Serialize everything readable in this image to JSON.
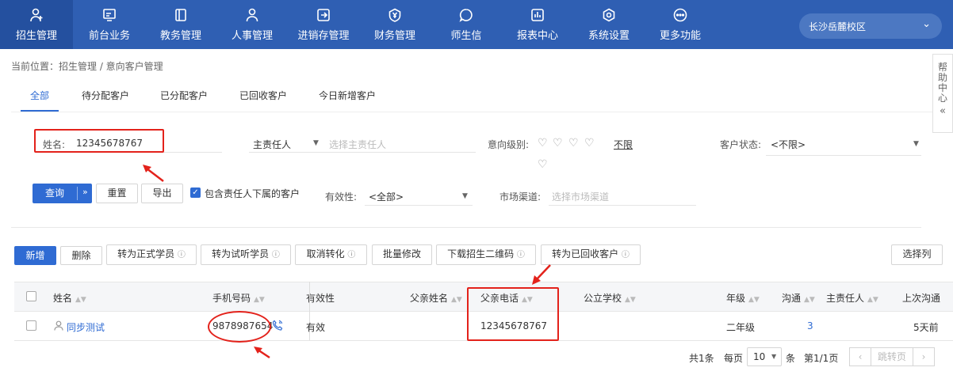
{
  "nav": {
    "items": [
      {
        "label": "招生管理",
        "icon": "user-add-icon",
        "active": true
      },
      {
        "label": "前台业务",
        "icon": "monitor-icon"
      },
      {
        "label": "教务管理",
        "icon": "book-icon"
      },
      {
        "label": "人事管理",
        "icon": "person-icon"
      },
      {
        "label": "进销存管理",
        "icon": "inventory-icon"
      },
      {
        "label": "财务管理",
        "icon": "yuan-shield-icon"
      },
      {
        "label": "师生信",
        "icon": "chat-icon"
      },
      {
        "label": "报表中心",
        "icon": "report-icon"
      },
      {
        "label": "系统设置",
        "icon": "settings-icon"
      },
      {
        "label": "更多功能",
        "icon": "more-icon"
      }
    ],
    "campus": "长沙岳麓校区"
  },
  "breadcrumb": "当前位置：招生管理 / 意向客户管理",
  "help": "帮助中心",
  "tabs": [
    "全部",
    "待分配客户",
    "已分配客户",
    "已回收客户",
    "今日新增客户"
  ],
  "filters": {
    "name_label": "姓名:",
    "name_value": "12345678767",
    "owner_label": "主责任人",
    "owner_placeholder": "选择主责任人",
    "level_label": "意向级别:",
    "level_unlimited": "不限",
    "status_label": "客户状态:",
    "status_value": "<不限>",
    "query": "查询",
    "reset": "重置",
    "export": "导出",
    "include_sub": "包含责任人下属的客户",
    "validity_label": "有效性:",
    "validity_value": "<全部>",
    "channel_label": "市场渠道:",
    "channel_placeholder": "选择市场渠道"
  },
  "actions": {
    "add": "新增",
    "delete": "删除",
    "to_formal": "转为正式学员",
    "to_trial": "转为试听学员",
    "cancel_convert": "取消转化",
    "batch_edit": "批量修改",
    "download_qr": "下载招生二维码",
    "to_recycled": "转为已回收客户",
    "select_columns": "选择列"
  },
  "table": {
    "headers": {
      "name": "姓名",
      "phone": "手机号码",
      "validity": "有效性",
      "father_name": "父亲姓名",
      "father_phone": "父亲电话",
      "school": "公立学校",
      "grade": "年级",
      "contact": "沟通",
      "owner": "主责任人",
      "last_contact": "上次沟通"
    },
    "rows": [
      {
        "name": "同步测试",
        "phone": "9878987654",
        "validity": "有效",
        "father_name": "",
        "father_phone": "12345678767",
        "school": "",
        "grade": "二年级",
        "contact": "3",
        "owner": "",
        "last_contact": "5天前"
      }
    ]
  },
  "pagination": {
    "total": "共1条",
    "per_page_label": "每页",
    "per_page": "10",
    "unit": "条",
    "page": "第1/1页",
    "jump": "跳转页"
  },
  "colors": {
    "nav_bg": "#2f5fb3",
    "accent": "#2f6bd3",
    "annotation": "#e3221b"
  }
}
